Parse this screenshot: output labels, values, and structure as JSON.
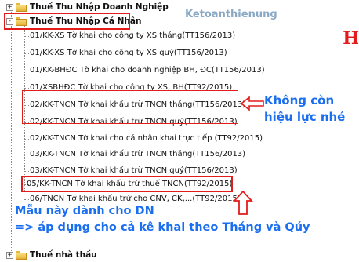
{
  "tree": {
    "group_top": {
      "label": "Thuế Thu Nhập Doanh Nghiệp",
      "expander": "+"
    },
    "group_main": {
      "label": "Thuế Thu Nhập Cá Nhân",
      "expander": "-"
    },
    "items": [
      "01/KK-XS Tờ khai cho công ty XS tháng(TT156/2013)",
      "01/KK-XS Tờ khai cho công ty XS quý(TT156/2013)",
      "01/KK-BHĐC Tờ khai cho doanh nghiệp BH, ĐC(TT156/2013)",
      "01/XSBHĐC Tờ khai cho công ty XS, BH(TT92/2015)",
      "02/KK-TNCN Tờ khai khấu trừ TNCN tháng(TT156/2013)",
      "02/KK-TNCN Tờ khai khấu trừ TNCN quý(TT156/2013)",
      "02/KK-TNCN Tờ khai cho cá nhân khai trực tiếp (TT92/2015)",
      "03/KK-TNCN Tờ khai khấu trừ TNCN tháng(TT156/2013)",
      "03/KK-TNCN Tờ khai khấu trừ TNCN quý(TT156/2013)",
      "05/KK-TNCN Tờ khai khấu trừ thuế TNCN(TT92/2015)",
      "06/TNCN Tờ khai khấu trừ cho CNV, CK,...(TT92/2015)"
    ],
    "group_bottom": {
      "label": "Thuế nhà thầu",
      "expander": "+"
    }
  },
  "watermark": "Ketoanthienung",
  "corner_logo": "H",
  "annotations": {
    "right_line1": "Không còn",
    "right_line2": "hiệu lực nhé",
    "bottom_line1": "Mẫu này dành cho DN",
    "bottom_line2": "=> áp dụng cho cả kê khai theo Tháng và Qúy"
  },
  "colors": {
    "highlight_red": "#e31b1b",
    "note_blue": "#1a6ef0",
    "watermark_blue": "#8aa9c6"
  }
}
